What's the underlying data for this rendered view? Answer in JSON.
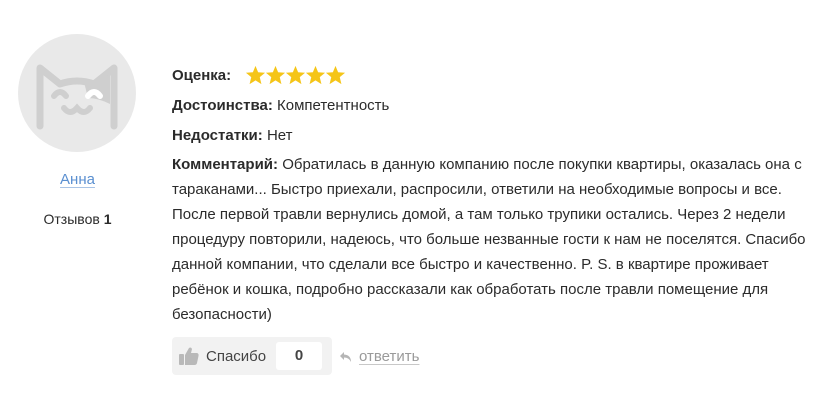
{
  "author": {
    "name": "Анна",
    "reviews_label": "Отзывов",
    "reviews_count": "1"
  },
  "rating": {
    "label": "Оценка:",
    "stars": 5,
    "max_stars": 5,
    "star_color": "#f5c518"
  },
  "pros": {
    "label": "Достоинства:",
    "value": "Компетентность"
  },
  "cons": {
    "label": "Недостатки:",
    "value": "Нет"
  },
  "comment": {
    "label": "Комментарий:",
    "text": "Обратилась в данную компанию после покупки квартиры, оказалась она с тараканами... Быстро приехали, распросили, ответили на необходимые вопросы и все. После первой травли вернулись домой, а там только трупики остались. Через 2 недели процедуру повторили, надеюсь, что больше незванные гости к нам не поселятся. Спасибо данной компании, что сделали все быстро и качественно. P. S. в квартире проживает ребёнок и кошка, подробно рассказали как обработать после травли помещение для безопасности)"
  },
  "actions": {
    "thanks_label": "Спасибо",
    "thanks_count": "0",
    "thanks_icon": "thumbs-up-icon",
    "reply_label": "ответить",
    "reply_icon": "reply-arrow-icon"
  },
  "colors": {
    "link": "#5a8fd0",
    "star": "#f5c518",
    "muted": "#9a9a9a"
  }
}
